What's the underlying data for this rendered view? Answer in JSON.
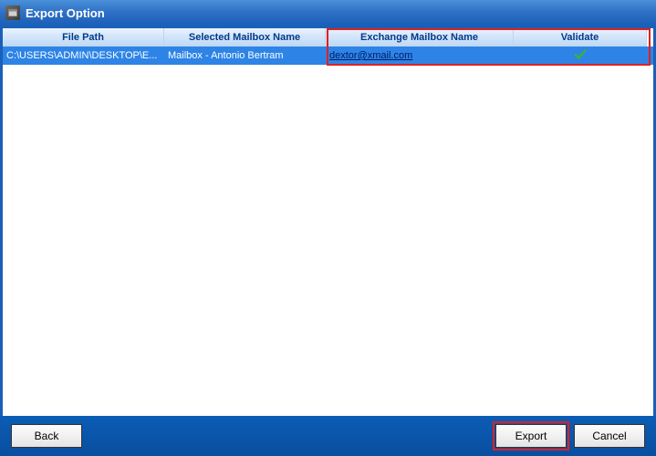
{
  "titlebar": {
    "title": "Export Option"
  },
  "table": {
    "headers": {
      "filepath": "File Path",
      "selected": "Selected Mailbox Name",
      "exchange": "Exchange Mailbox Name",
      "validate": "Validate"
    },
    "rows": [
      {
        "filepath": "C:\\USERS\\ADMIN\\DESKTOP\\E...",
        "selected": "Mailbox - Antonio Bertram",
        "exchange": "dextor@xmail.com",
        "validated": true
      }
    ]
  },
  "buttons": {
    "back": "Back",
    "export": "Export",
    "cancel": "Cancel"
  }
}
